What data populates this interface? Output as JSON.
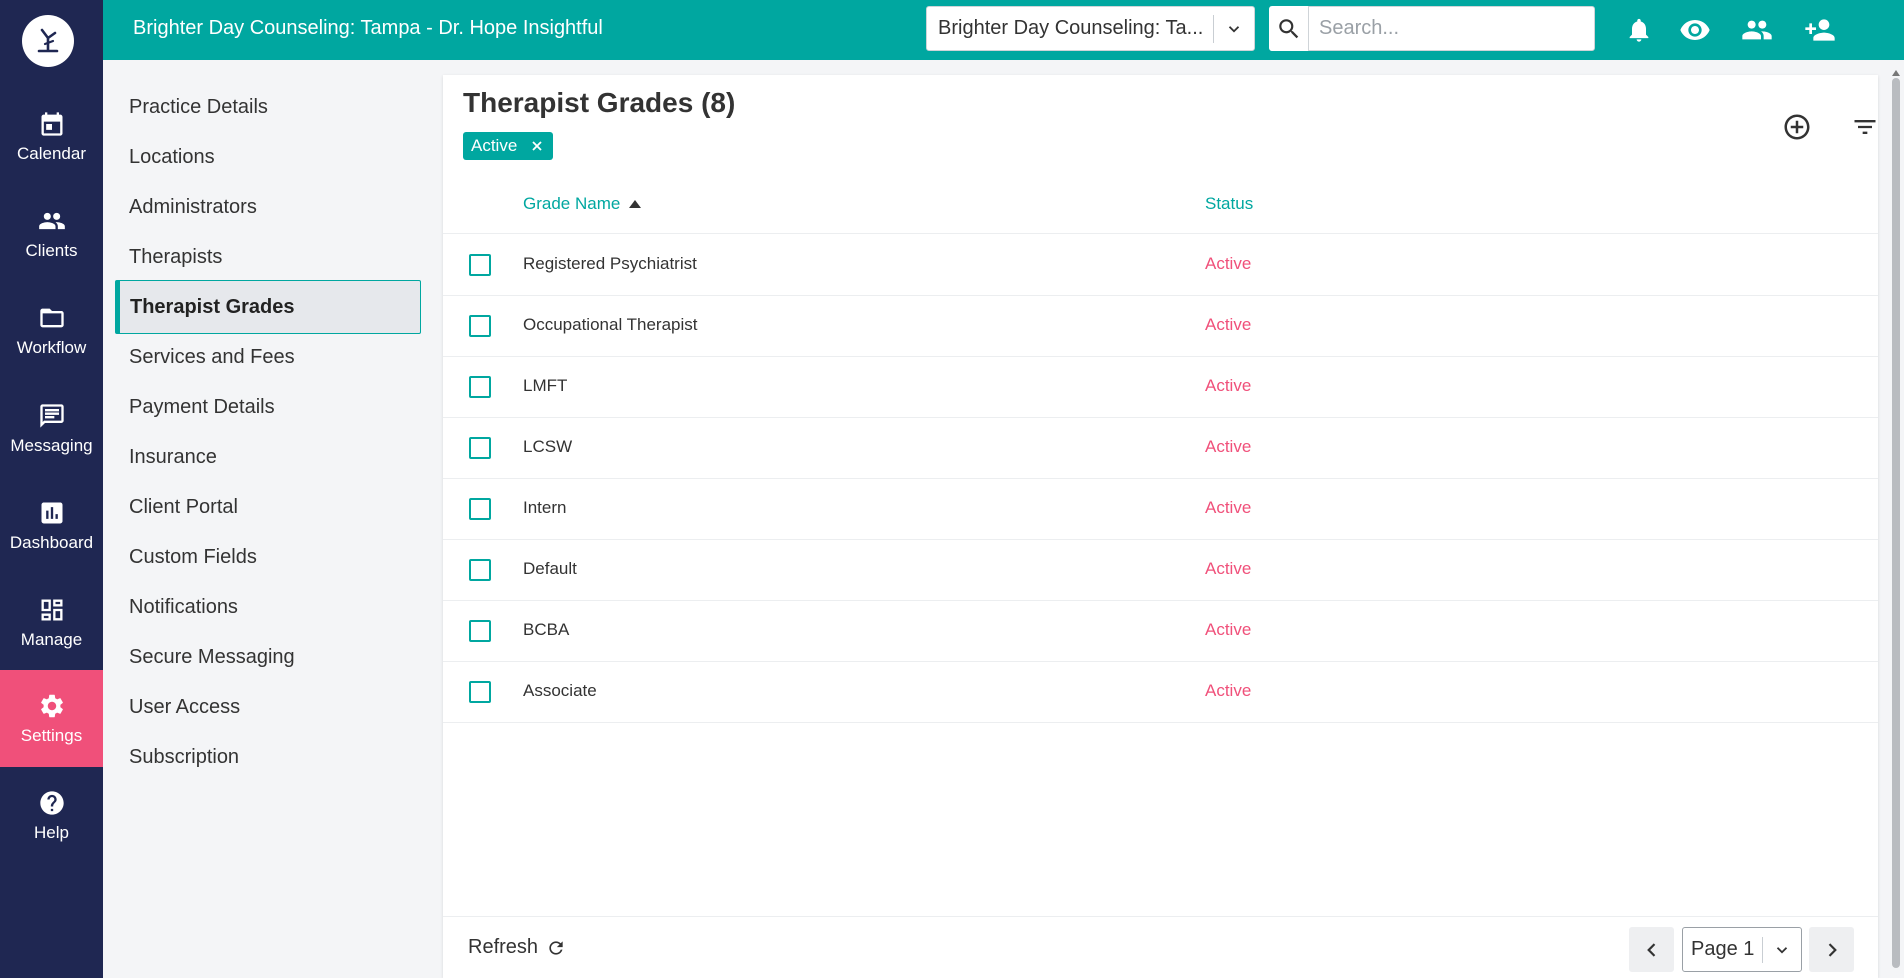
{
  "topbar": {
    "title": "Brighter Day Counseling: Tampa - Dr. Hope Insightful",
    "practice_select_value": "Brighter Day Counseling: Ta...",
    "search_placeholder": "Search..."
  },
  "rail": {
    "items": [
      {
        "label": "Calendar",
        "icon": "calendar-icon"
      },
      {
        "label": "Clients",
        "icon": "people-icon"
      },
      {
        "label": "Workflow",
        "icon": "folder-icon"
      },
      {
        "label": "Messaging",
        "icon": "chat-icon"
      },
      {
        "label": "Dashboard",
        "icon": "chart-icon"
      },
      {
        "label": "Manage",
        "icon": "dashboard-icon"
      },
      {
        "label": "Settings",
        "icon": "gear-icon"
      },
      {
        "label": "Help",
        "icon": "help-icon"
      }
    ],
    "active": "Settings"
  },
  "settings_nav": {
    "items": [
      "Practice Details",
      "Locations",
      "Administrators",
      "Therapists",
      "Therapist Grades",
      "Services and Fees",
      "Payment Details",
      "Insurance",
      "Client Portal",
      "Custom Fields",
      "Notifications",
      "Secure Messaging",
      "User Access",
      "Subscription"
    ],
    "active": "Therapist Grades"
  },
  "main": {
    "title": "Therapist Grades (8)",
    "filter_chip": "Active",
    "columns": {
      "grade_name": "Grade Name",
      "status": "Status"
    },
    "rows": [
      {
        "name": "Registered Psychiatrist",
        "status": "Active"
      },
      {
        "name": "Occupational Therapist",
        "status": "Active"
      },
      {
        "name": "LMFT",
        "status": "Active"
      },
      {
        "name": "LCSW",
        "status": "Active"
      },
      {
        "name": "Intern",
        "status": "Active"
      },
      {
        "name": "Default",
        "status": "Active"
      },
      {
        "name": "BCBA",
        "status": "Active"
      },
      {
        "name": "Associate",
        "status": "Active"
      }
    ],
    "refresh_label": "Refresh",
    "page_select_value": "Page 1"
  },
  "colors": {
    "teal": "#00a7a0",
    "navy": "#1f2752",
    "pink": "#f0507a"
  }
}
